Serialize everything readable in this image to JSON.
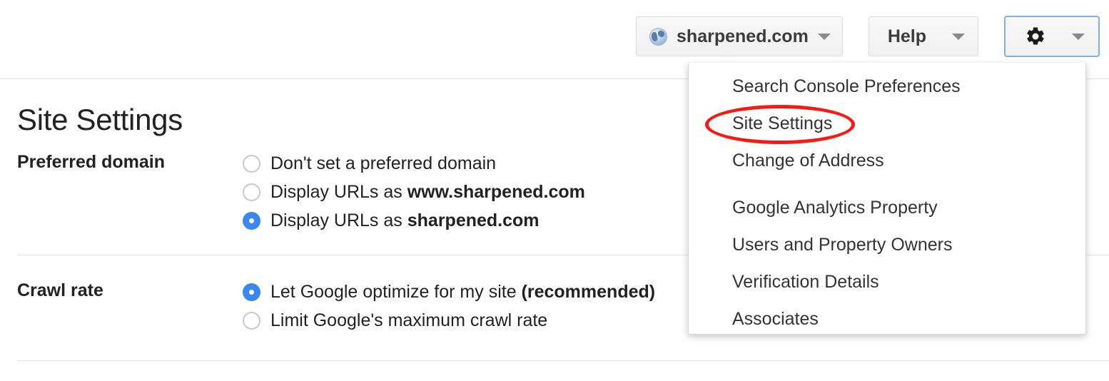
{
  "topbar": {
    "site_selector": {
      "label": "sharpened.com",
      "icon": "globe-icon",
      "caret": "chevron-down-icon"
    },
    "help": {
      "label": "Help",
      "caret": "chevron-down-icon"
    },
    "settings": {
      "icon": "gear-icon",
      "caret": "chevron-down-icon",
      "focus_color": "#7eb1f2"
    }
  },
  "settings_menu": {
    "open": true,
    "items": [
      {
        "label": "Search Console Preferences"
      },
      {
        "label": "Site Settings",
        "highlighted": true
      },
      {
        "label": "Change of Address"
      },
      {
        "label": "Google Analytics Property"
      },
      {
        "label": "Users and Property Owners"
      },
      {
        "label": "Verification Details"
      },
      {
        "label": "Associates"
      }
    ],
    "annotation": {
      "shape": "ellipse",
      "color": "#f51b14",
      "target": "Site Settings"
    }
  },
  "main": {
    "title": "Site Settings",
    "sections": [
      {
        "label": "Preferred domain",
        "options": [
          {
            "text": "Don't set a preferred domain",
            "bold": "",
            "checked": false
          },
          {
            "text": "Display URLs as ",
            "bold": "www.sharpened.com",
            "checked": false
          },
          {
            "text": "Display URLs as ",
            "bold": "sharpened.com",
            "checked": true
          }
        ]
      },
      {
        "label": "Crawl rate",
        "options": [
          {
            "text": "Let Google optimize for my site ",
            "bold": "(recommended)",
            "checked": true
          },
          {
            "text": "Limit Google's maximum crawl rate",
            "bold": "",
            "checked": false
          }
        ]
      }
    ]
  },
  "colors": {
    "radio_selected": "#3b87f0",
    "annotation_red": "#f51b14",
    "divider": "#e4e4e4",
    "text": "#222222"
  }
}
